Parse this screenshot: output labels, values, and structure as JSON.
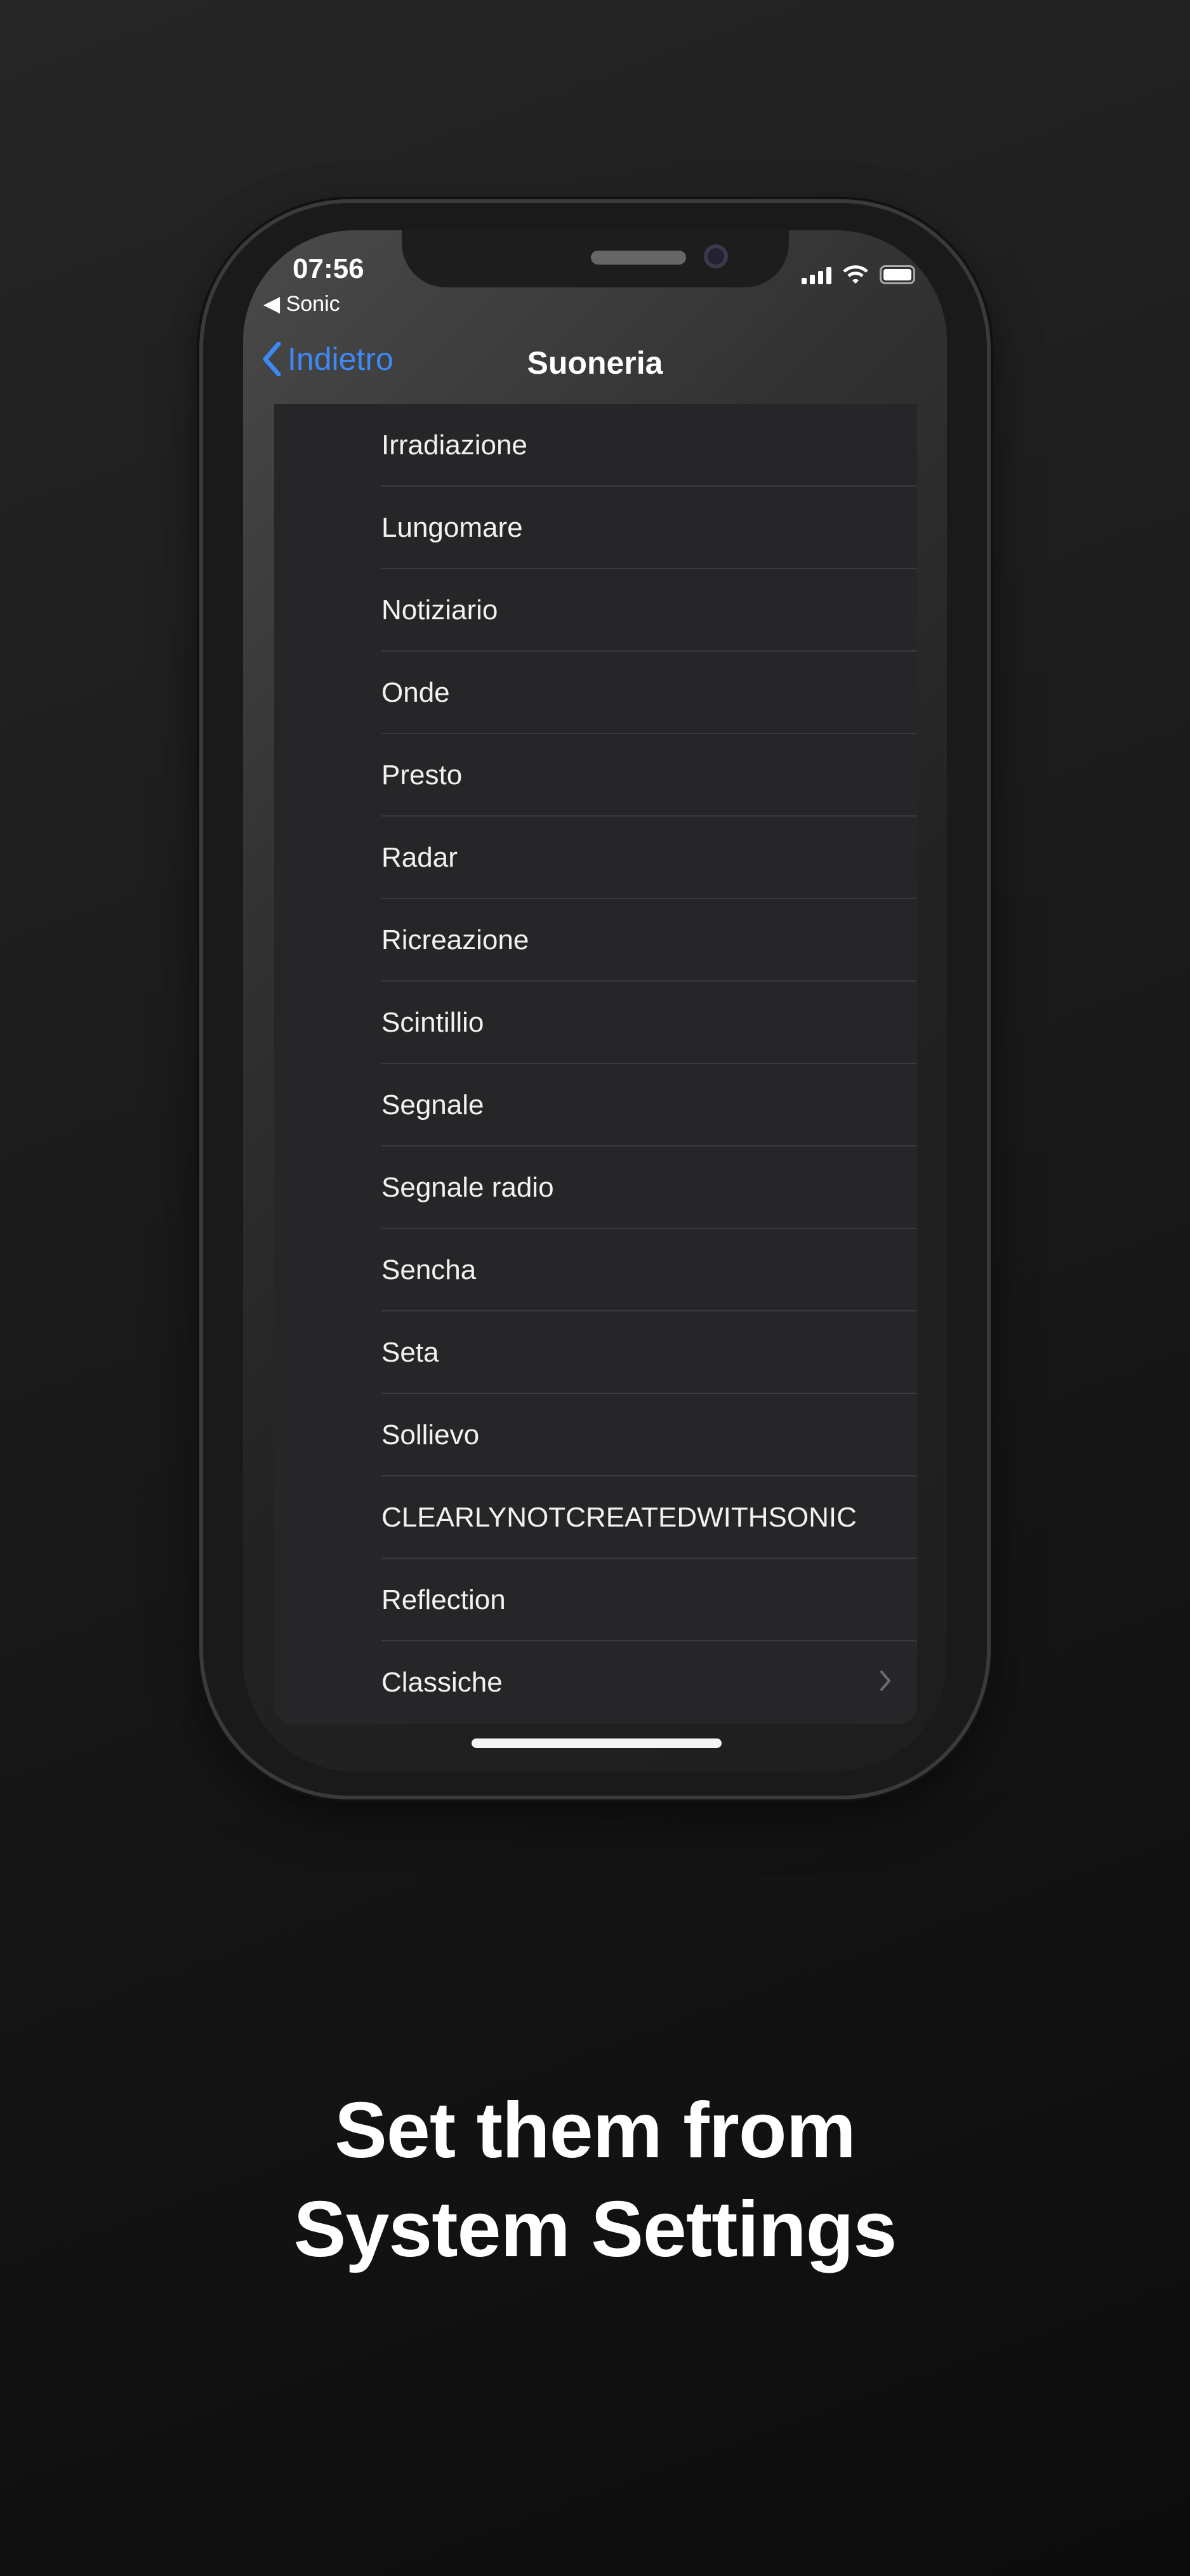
{
  "status_bar": {
    "time": "07:56",
    "back_app": "◀ Sonic"
  },
  "navbar": {
    "back_label": "Indietro",
    "title": "Suoneria"
  },
  "ringtones": [
    {
      "label": "Irradiazione"
    },
    {
      "label": "Lungomare"
    },
    {
      "label": "Notiziario"
    },
    {
      "label": "Onde"
    },
    {
      "label": "Presto"
    },
    {
      "label": "Radar"
    },
    {
      "label": "Ricreazione"
    },
    {
      "label": "Scintillio"
    },
    {
      "label": "Segnale"
    },
    {
      "label": "Segnale radio"
    },
    {
      "label": "Sencha"
    },
    {
      "label": "Seta"
    },
    {
      "label": "Sollievo"
    },
    {
      "label": "CLEARLYNOTCREATEDWITHSONIC"
    },
    {
      "label": "Reflection"
    },
    {
      "label": "Classiche",
      "disclosure": true
    }
  ],
  "headline": {
    "line1": "Set them from",
    "line2": "System Settings"
  },
  "colors": {
    "accent": "#3d8af7",
    "list_bg": "#262628",
    "background": "#1b1b1b"
  }
}
